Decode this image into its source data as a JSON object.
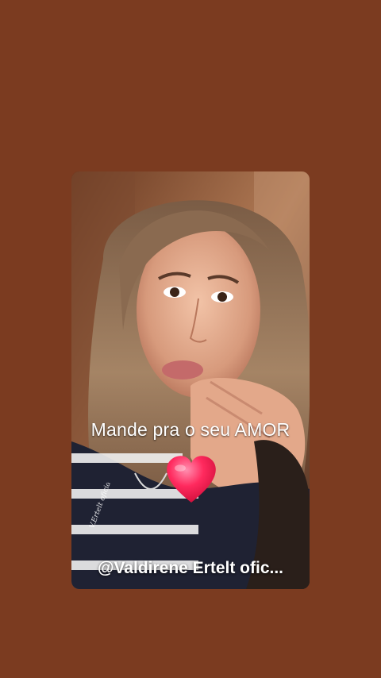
{
  "story": {
    "caption": "Mande pra o seu AMOR",
    "handle": "@Valdirene Ertelt ofic...",
    "signature": "V.Ertelt oficial",
    "heart_icon": "heart-emoji"
  },
  "colors": {
    "background": "#7b3b20",
    "text": "#ffffff",
    "heart": "#ff2a5e"
  }
}
